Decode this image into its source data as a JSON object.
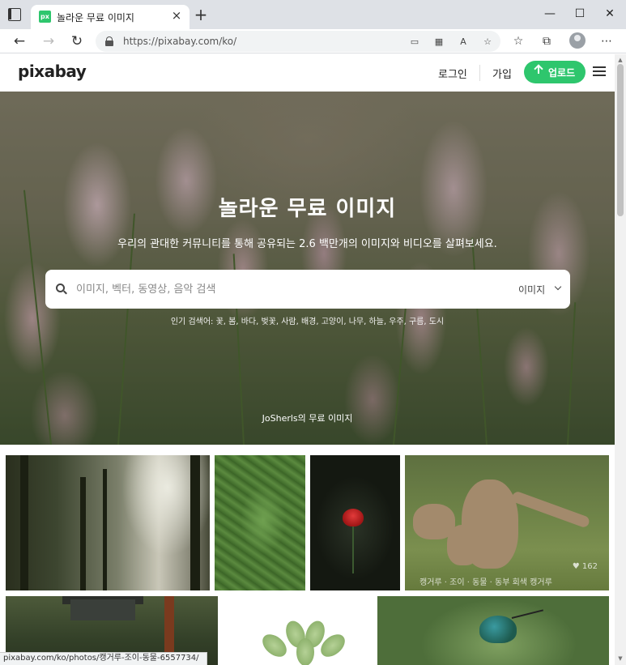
{
  "browser": {
    "tab_title": "놀라운 무료 이미지",
    "favicon_text": "px",
    "url": "https://pixabay.com/ko/",
    "status_url": "pixabay.com/ko/photos/캥거루-조이-동물-6557734/",
    "window_controls": {
      "minimize": "—",
      "maximize": "☐",
      "close": "✕"
    }
  },
  "header": {
    "logo": "pixabay",
    "login": "로그인",
    "signup": "가입",
    "upload": "업로드"
  },
  "hero": {
    "title": "놀라운 무료 이미지",
    "subtitle": "우리의 관대한 커뮤니티를 통해 공유되는 2.6 백만개의 이미지와 비디오를 살펴보세요.",
    "search_placeholder": "이미지, 벡터, 동영상, 음악 검색",
    "search_type": "이미지",
    "popular": "인기 검색어: 꽃, 봄, 바다, 벚꽃, 사람, 배경, 고양이, 나무, 하늘, 우주, 구름, 도시",
    "credit": "JoSherls의 무료 이미지"
  },
  "gallery": {
    "kangaroo_caption": "캥거루 · 조이 · 동물 · 동부 회색 캥거루",
    "kangaroo_likes": "♥ 162"
  },
  "colors": {
    "accent": "#2ec66d"
  }
}
